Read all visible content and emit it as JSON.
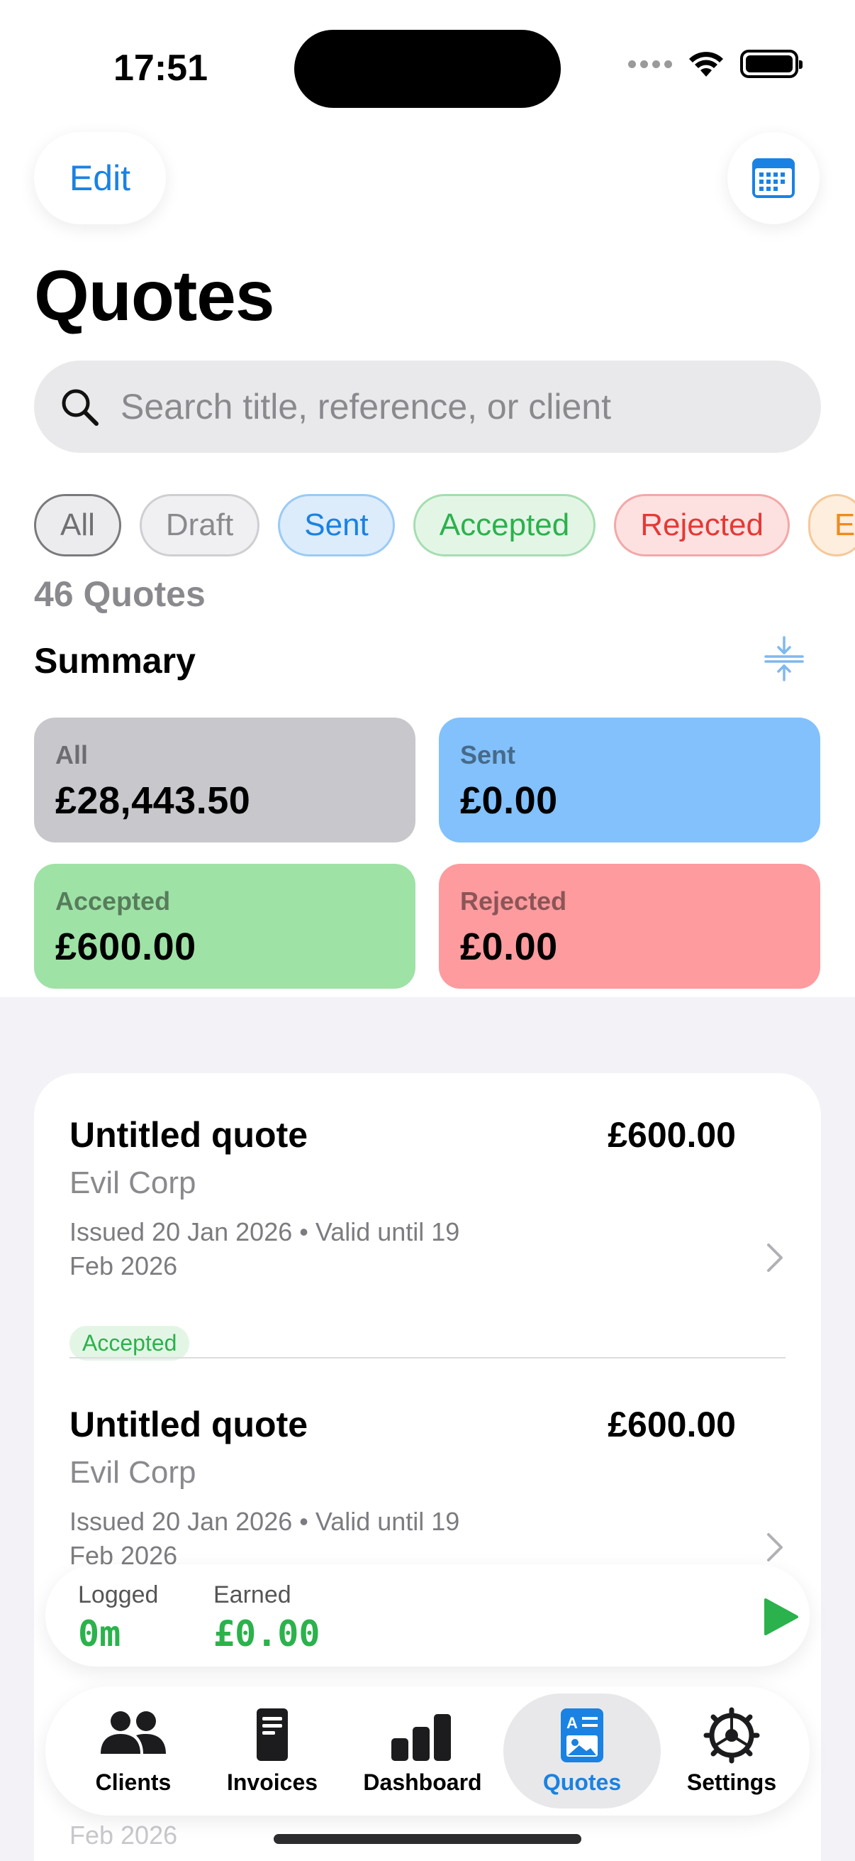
{
  "status_bar": {
    "time": "17:51"
  },
  "header": {
    "edit_label": "Edit",
    "title": "Quotes"
  },
  "search": {
    "placeholder": "Search title, reference, or client"
  },
  "filters": [
    "All",
    "Draft",
    "Sent",
    "Accepted",
    "Rejected",
    "E"
  ],
  "count_label": "46 Quotes",
  "summary": {
    "title": "Summary",
    "cards": [
      {
        "label": "All",
        "value": "£28,443.50",
        "color": "#c7c7cc"
      },
      {
        "label": "Sent",
        "value": "£0.00",
        "color": "#82c1fb"
      },
      {
        "label": "Accepted",
        "value": "£600.00",
        "color": "#9ee2a6"
      },
      {
        "label": "Rejected",
        "value": "£0.00",
        "color": "#fd9b9e"
      }
    ]
  },
  "quotes": [
    {
      "title": "Untitled quote",
      "amount": "£600.00",
      "client": "Evil Corp",
      "dates": "Issued 20 Jan 2026 • Valid until 19 Feb 2026",
      "status": "Accepted"
    },
    {
      "title": "Untitled quote",
      "amount": "£600.00",
      "client": "Evil Corp",
      "dates": "Issued 20 Jan 2026 • Valid until 19 Feb 2026",
      "status": ""
    }
  ],
  "peek_row": {
    "dates_tail": "Feb 2026"
  },
  "timer": {
    "logged_label": "Logged",
    "logged_value": "0m",
    "earned_label": "Earned",
    "earned_value": "£0.00"
  },
  "tabs": [
    {
      "label": "Clients",
      "icon": "people-icon"
    },
    {
      "label": "Invoices",
      "icon": "document-icon"
    },
    {
      "label": "Dashboard",
      "icon": "bar-chart-icon"
    },
    {
      "label": "Quotes",
      "icon": "quote-icon",
      "active": true
    },
    {
      "label": "Settings",
      "icon": "gear-icon"
    }
  ],
  "colors": {
    "accent": "#1a82e2",
    "green": "#2bb24c",
    "red": "#e53935"
  }
}
